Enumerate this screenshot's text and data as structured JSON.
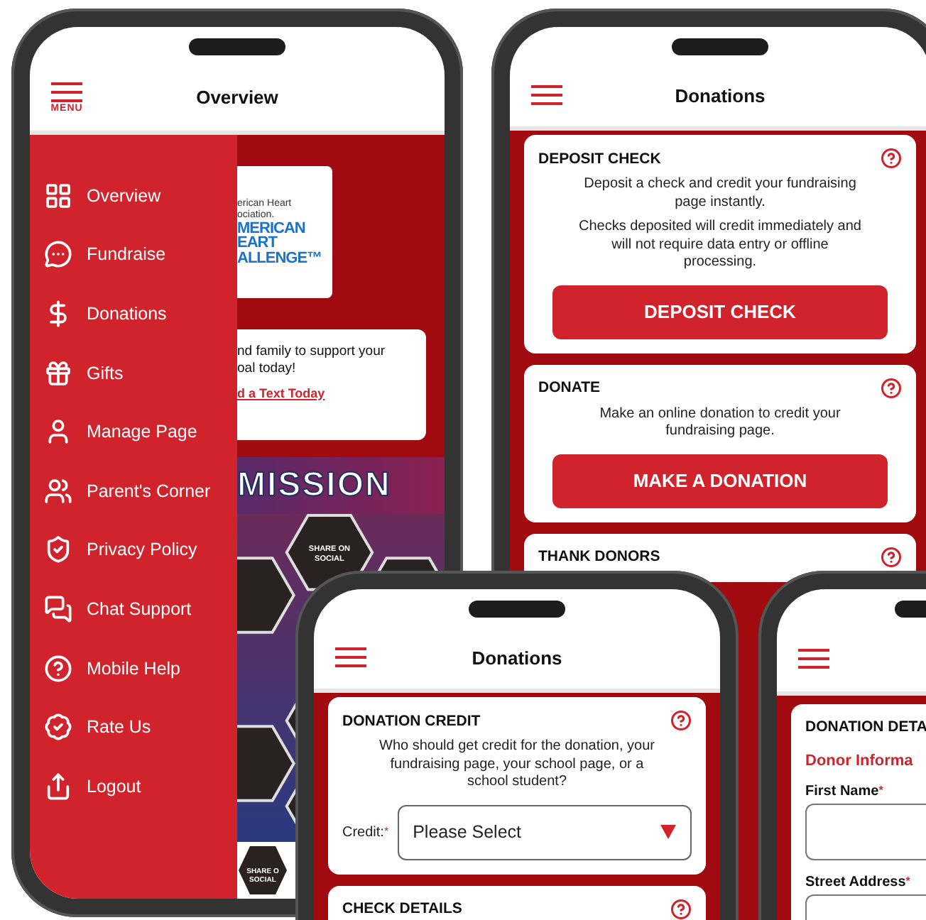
{
  "overview_screen": {
    "title": "Overview",
    "menu_label": "MENU",
    "menu_items": [
      {
        "label": "Overview"
      },
      {
        "label": "Fundraise"
      },
      {
        "label": "Donations"
      },
      {
        "label": "Gifts"
      },
      {
        "label": "Manage Page"
      },
      {
        "label": "Parent's Corner"
      },
      {
        "label": "Privacy Policy"
      },
      {
        "label": "Chat Support"
      },
      {
        "label": "Mobile Help"
      },
      {
        "label": "Rate Us"
      },
      {
        "label": "Logout"
      }
    ],
    "logo_small_lines": [
      "erican Heart",
      "ociation."
    ],
    "logo_big_lines": [
      "MERICAN",
      "EART",
      "ALLENGE™"
    ],
    "promo_lines": [
      "nd family to support your",
      "oal today!"
    ],
    "promo_link": "d a Text Today",
    "banner": "MISSION",
    "hexagon_label": [
      "SHARE ON",
      "SOCIAL"
    ],
    "bottom_hexagon_label": [
      "SHARE O",
      "SOCIAL"
    ]
  },
  "donations_screen": {
    "title": "Donations",
    "cards": [
      {
        "title": "DEPOSIT CHECK",
        "paragraphs": [
          "Deposit a check and credit your fundraising page instantly.",
          "Checks deposited will credit immediately and will not require data entry or offline processing."
        ],
        "button": "DEPOSIT CHECK"
      },
      {
        "title": "DONATE",
        "paragraphs": [
          "Make an online donation to credit your fundraising page."
        ],
        "button": "MAKE A DONATION"
      },
      {
        "title": "THANK DONORS"
      }
    ]
  },
  "credit_screen": {
    "title": "Donations",
    "cards": [
      {
        "title": "DONATION CREDIT",
        "text": "Who should get credit for the donation, your fundraising page, your school page, or a school student?",
        "field": {
          "label": "Credit:",
          "required_mark": "*",
          "value": "Please Select"
        }
      },
      {
        "title": "CHECK DETAILS"
      }
    ]
  },
  "details_screen": {
    "card_title": "DONATION DETA",
    "section": "Donor Informa",
    "fields": [
      {
        "label": "First Name",
        "required_mark": "*"
      },
      {
        "label": "Street Address",
        "required_mark": "*"
      }
    ]
  }
}
